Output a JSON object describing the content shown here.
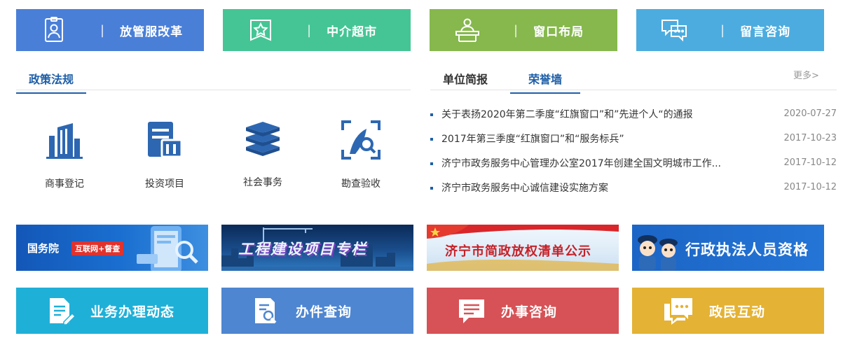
{
  "top_tiles": [
    {
      "label": "放管服改革",
      "icon": "id-badge-icon",
      "color": "#4a7fd8"
    },
    {
      "label": "中介超市",
      "icon": "star-ribbon-icon",
      "color": "#45c595"
    },
    {
      "label": "窗口布局",
      "icon": "service-counter-icon",
      "color": "#86b84d"
    },
    {
      "label": "留言咨询",
      "icon": "chat-bubbles-icon",
      "color": "#4cacdf"
    }
  ],
  "separator": "|",
  "policy": {
    "heading": "政策法规",
    "items": [
      {
        "label": "商事登记",
        "icon": "building-icon"
      },
      {
        "label": "投资项目",
        "icon": "document-stack-icon"
      },
      {
        "label": "社会事务",
        "icon": "books-icon"
      },
      {
        "label": "勘查验收",
        "icon": "scan-inspection-icon"
      }
    ]
  },
  "news": {
    "tabs": [
      "单位简报",
      "荣誉墙"
    ],
    "active_tab": 1,
    "more": "更多>",
    "items": [
      {
        "title": "关于表扬2020年第二季度“红旗窗口”和”先进个人“的通报",
        "date": "2020-07-27"
      },
      {
        "title": "2017年第三季度“红旗窗口”和“服务标兵”",
        "date": "2017-10-23"
      },
      {
        "title": "济宁市政务服务中心管理办公室2017年创建全国文明城市工作...",
        "date": "2017-10-12"
      },
      {
        "title": "济宁市政务服务中心诚信建设实施方案",
        "date": "2017-10-12"
      }
    ]
  },
  "banners": {
    "guowuyuan": {
      "title": "国务院",
      "badge": "互联网+督查"
    },
    "engineering": {
      "title": "工程建设项目专栏"
    },
    "jining": {
      "title": "济宁市简政放权清单公示"
    },
    "enforcement": {
      "title": "行政执法人员资格"
    }
  },
  "bottom_tiles": [
    {
      "label": "业务办理动态",
      "icon": "document-edit-icon",
      "color": "#1fb0d8"
    },
    {
      "label": "办件查询",
      "icon": "document-search-icon",
      "color": "#4e86d1"
    },
    {
      "label": "办事咨询",
      "icon": "message-icon",
      "color": "#d65256"
    },
    {
      "label": "政民互动",
      "icon": "chat-dots-icon",
      "color": "#e4b234"
    }
  ]
}
